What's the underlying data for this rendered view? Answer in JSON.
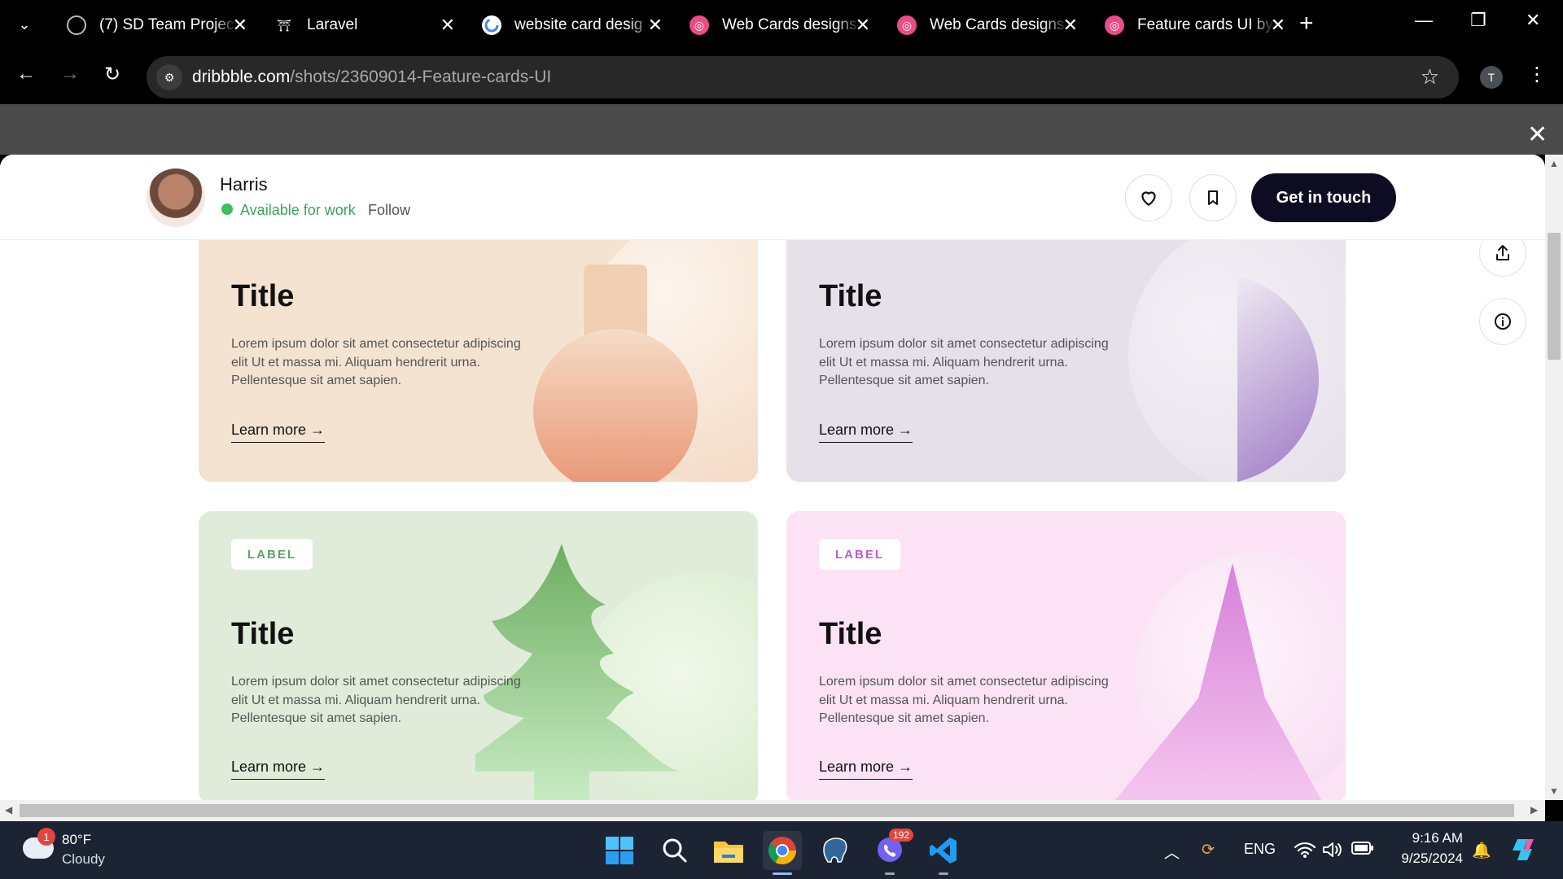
{
  "browser": {
    "tabs": [
      {
        "title": "(7) SD Team Projec",
        "icon": "target-icon"
      },
      {
        "title": "Laravel",
        "icon": "laravel-icon"
      },
      {
        "title": "website card desig",
        "icon": "google-icon"
      },
      {
        "title": "Web Cards designs",
        "icon": "dribbble-icon"
      },
      {
        "title": "Web Cards designs",
        "icon": "dribbble-icon"
      },
      {
        "title": "Feature cards UI by",
        "icon": "dribbble-icon"
      }
    ],
    "url_host": "dribbble.com",
    "url_path": "/shots/23609014-Feature-cards-UI",
    "profile_initial": "T"
  },
  "modal": {
    "designer_name": "Harris",
    "availability": "Available for work",
    "follow_label": "Follow",
    "cta_label": "Get in touch"
  },
  "cards": [
    {
      "title": "Title",
      "body": "Lorem ipsum dolor sit amet consectetur adipiscing elit Ut et massa mi. Aliquam hendrerit urna. Pellentesque sit amet sapien.",
      "link": "Learn more →",
      "bg": "#f5e3d2"
    },
    {
      "title": "Title",
      "body": "Lorem ipsum dolor sit amet consectetur adipiscing elit Ut et massa mi. Aliquam hendrerit urna. Pellentesque sit amet sapien.",
      "link": "Learn  more →",
      "bg": "#e5e0ea"
    },
    {
      "label": "LABEL",
      "label_color": "#5aa55e",
      "title": "Title",
      "body": "Lorem ipsum dolor sit amet consectetur adipiscing elit Ut et massa mi. Aliquam hendrerit urna. Pellentesque sit amet sapien.",
      "link": "Learn  more →",
      "bg": "#e0ecd9"
    },
    {
      "label": "LABEL",
      "label_color": "#c35ad0",
      "title": "Title",
      "body": "Lorem ipsum dolor sit amet consectetur adipiscing elit Ut et massa mi. Aliquam hendrerit urna. Pellentesque sit amet sapien.",
      "link": "Learn  more →",
      "bg": "#fbe3f5"
    }
  ],
  "taskbar": {
    "weather_temp": "80°F",
    "weather_desc": "Cloudy",
    "weather_badge": "1",
    "viber_badge": "192",
    "language": "ENG",
    "time": "9:16 AM",
    "date": "9/25/2024"
  },
  "colors": {
    "cta_bg": "#0e0c22",
    "available_green": "#3aa356"
  }
}
